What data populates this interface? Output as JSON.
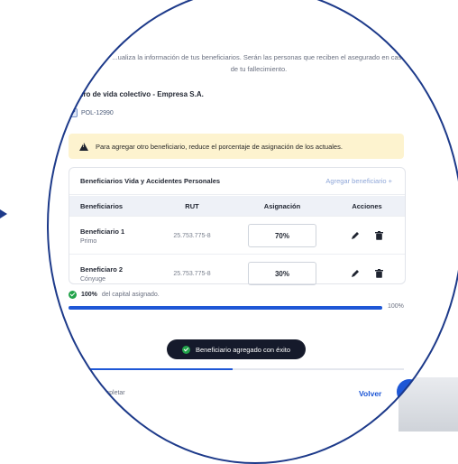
{
  "intro_text": "...ualiza la información de tus beneficiarios. Serán las personas que reciben el asegurado en caso de tu fallecimiento.",
  "policy": {
    "title": "...guro de vida colectivo - Empresa S.A.",
    "number": "POL-12990",
    "checked": true
  },
  "warning": {
    "icon": "warning-triangle-icon",
    "text": "Para agregar otro beneficiario, reduce el porcentaje de asignación de los actuales."
  },
  "table": {
    "title": "Beneficiarios Vida y Accidentes Personales",
    "add_label": "Agregar beneficiario +",
    "columns": [
      "Beneficiarios",
      "RUT",
      "Asignación",
      "Acciones"
    ],
    "rows": [
      {
        "name": "Beneficiario 1",
        "relation": "Primo",
        "rut": "25.753.775-8",
        "allocation": "70%"
      },
      {
        "name": "Beneficiaro 2",
        "relation": "Cónyuge",
        "rut": "25.753.775-8",
        "allocation": "30%"
      }
    ]
  },
  "summary": {
    "strong": "100%",
    "rest": "del capital asignado."
  },
  "progress": {
    "percent": 100,
    "label": "100%"
  },
  "toast": {
    "text": "Beneficiario agregado con éxito"
  },
  "stepper": {
    "fraction": 0.5
  },
  "footer": {
    "left_text": "...por completar",
    "right_button": "Volver"
  },
  "colors": {
    "primary": "#1e57d6",
    "success": "#22a34a",
    "warning_bg": "#fdf3cf",
    "ring": "#1d3a8a"
  }
}
